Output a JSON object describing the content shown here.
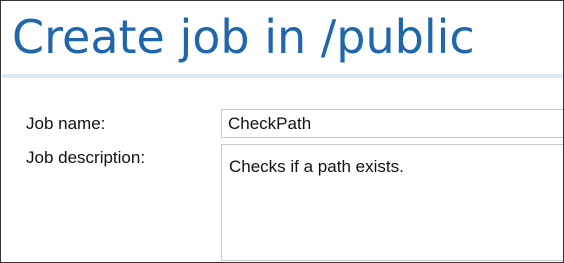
{
  "page": {
    "title": "Create job in /public"
  },
  "form": {
    "job_name": {
      "label": "Job name:",
      "value": "CheckPath"
    },
    "job_description": {
      "label": "Job description:",
      "value": "Checks if a path exists."
    }
  },
  "colors": {
    "title": "#1f66ad",
    "border": "#333333",
    "input_border": "#c9c9c9"
  }
}
